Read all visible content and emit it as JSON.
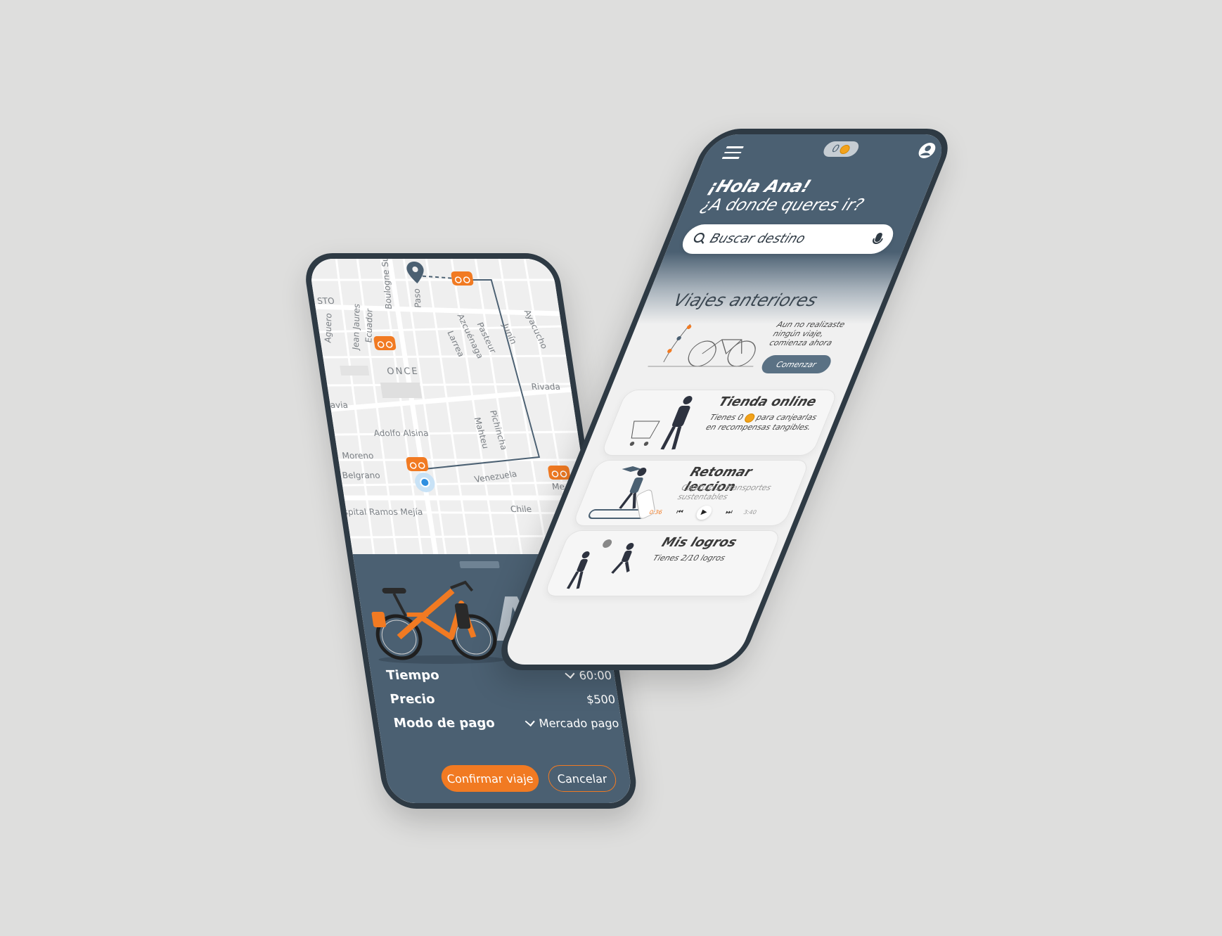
{
  "left_phone": {
    "map": {
      "street_labels": [
        "STO",
        "Aguero",
        "Jean Jaures",
        "Ecuador",
        "Boulogne Sur M",
        "Paso",
        "Azcuénaga",
        "Larrea",
        "Pasteur",
        "Junín",
        "Ayacucho",
        "ONCE",
        "Rivada",
        "avia",
        "Adolfo Alsina",
        "Mahteu",
        "Pichincha",
        "Moreno",
        "Belgrano",
        "Venezuela",
        "Me",
        "spital Ramos Mejía",
        "Chile"
      ]
    },
    "bike_code": "AA01",
    "tiempo_label": "Tiempo",
    "tiempo_value": "60:00",
    "precio_label": "Precio",
    "precio_value": "$500",
    "pago_label": "Modo de pago",
    "pago_value": "Mercado pago",
    "confirm_label": "Confirmar viaje",
    "cancel_label": "Cancelar",
    "accent": "#f17a22",
    "sheet_color": "#4b6072"
  },
  "right_phone": {
    "coins": "0",
    "greeting": "¡Hola Ana!",
    "question": "¿A donde queres ir?",
    "search_placeholder": "Buscar destino",
    "trips_title": "Viajes anteriores",
    "no_trips": "Aun no realizaste ningún viaje, comienza ahora",
    "start_label": "Comenzar",
    "shop_title": "Tienda online",
    "shop_sub_a": "Tienes 0",
    "shop_sub_b": "para canjearlas en recompensas tangibles.",
    "lesson_title": "Retomar leccion",
    "lesson_sub": "Capitulo 2: transportes sustentables",
    "audio_current": "0:36",
    "audio_total": "3:40",
    "achievements_title": "Mis logros",
    "achievements_sub": "Tienes 2/10 logros",
    "header_color": "#4b6072"
  }
}
